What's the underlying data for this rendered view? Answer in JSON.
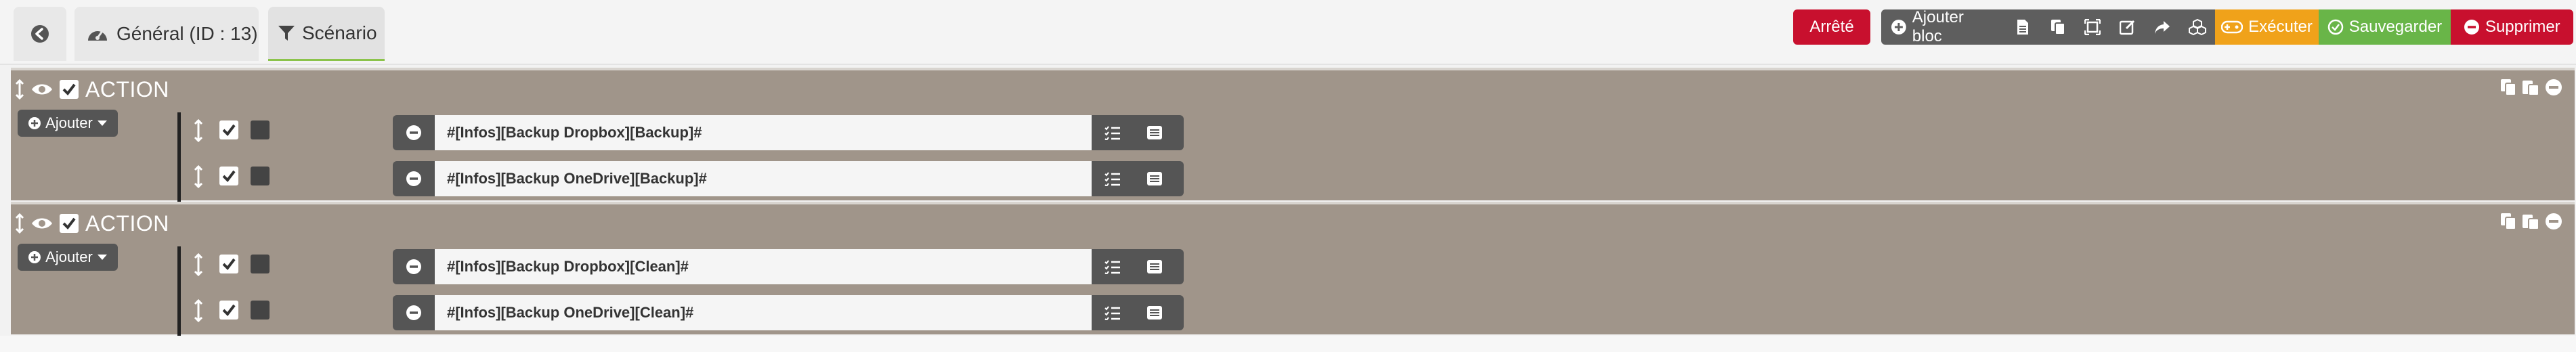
{
  "tabs": {
    "back_icon": "arrow-left-circle-icon",
    "general_label": "Général (ID : 13)",
    "general_icon": "dashboard-gauge-icon",
    "scenario_label": "Scénario",
    "scenario_icon": "filter-icon"
  },
  "toolbar": {
    "state_label": "Arrêté",
    "add_block_label": "Ajouter bloc",
    "execute_label": "Exécuter",
    "save_label": "Sauvegarder",
    "delete_label": "Supprimer",
    "colors": {
      "state": "#c8102e",
      "execute": "#f0a21a",
      "save": "#69b548",
      "delete": "#c8102e",
      "tools": "#5e5e5e"
    }
  },
  "blocks": [
    {
      "title": "ACTION",
      "add_label": "Ajouter",
      "actions": [
        {
          "expression": "#[Infos][Backup Dropbox][Backup]#",
          "enabled": true,
          "background": false
        },
        {
          "expression": "#[Infos][Backup OneDrive][Backup]#",
          "enabled": true,
          "background": false
        }
      ]
    },
    {
      "title": "ACTION",
      "add_label": "Ajouter",
      "actions": [
        {
          "expression": "#[Infos][Backup Dropbox][Clean]#",
          "enabled": true,
          "background": false
        },
        {
          "expression": "#[Infos][Backup OneDrive][Clean]#",
          "enabled": true,
          "background": false
        }
      ]
    }
  ],
  "block_color": "#a0958a"
}
